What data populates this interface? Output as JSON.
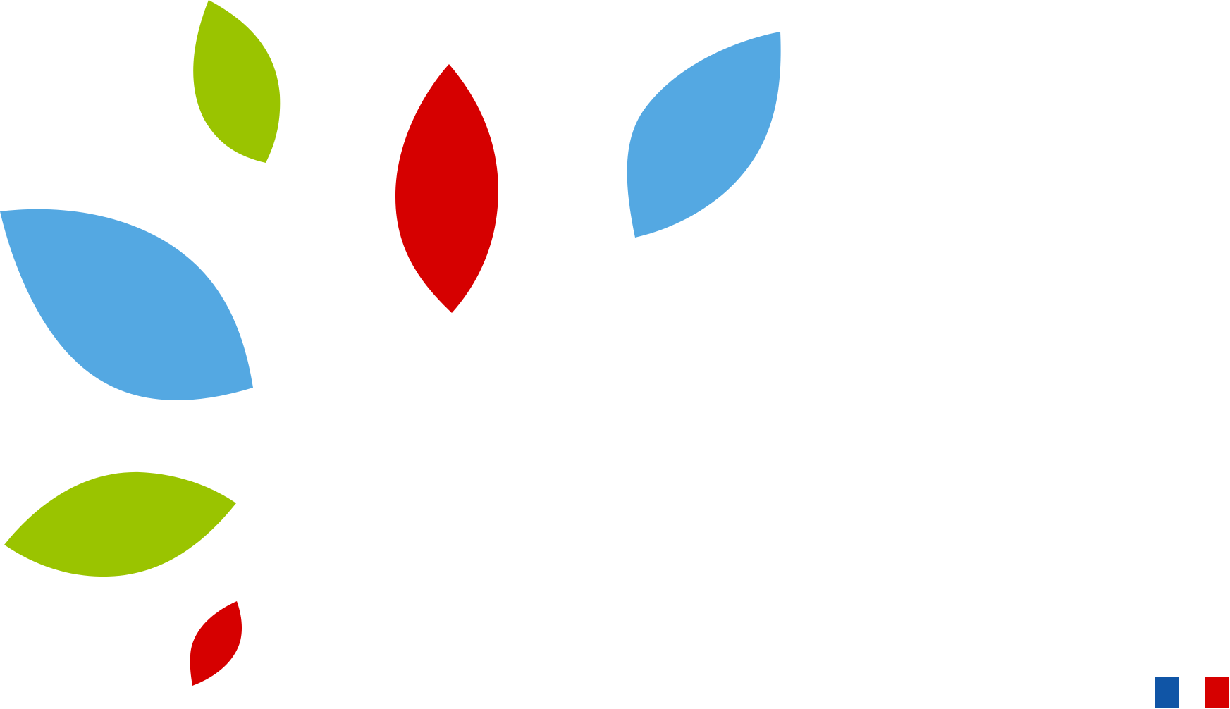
{
  "colors": {
    "background": "#ffffff",
    "leaf_green": "#9ac400",
    "leaf_red": "#d60000",
    "leaf_blue": "#54a8e2",
    "swatch_blue": "#1055a6",
    "swatch_red": "#d60000"
  },
  "leaves": [
    {
      "name": "green-leaf-top",
      "color": "leaf_green"
    },
    {
      "name": "red-leaf-center",
      "color": "leaf_red"
    },
    {
      "name": "blue-leaf-right",
      "color": "leaf_blue"
    },
    {
      "name": "blue-leaf-left",
      "color": "leaf_blue"
    },
    {
      "name": "green-leaf-bottom",
      "color": "leaf_green"
    },
    {
      "name": "red-leaf-small",
      "color": "leaf_red"
    }
  ],
  "swatches": [
    {
      "name": "blue-swatch",
      "color": "swatch_blue"
    },
    {
      "name": "red-swatch",
      "color": "swatch_red"
    }
  ]
}
